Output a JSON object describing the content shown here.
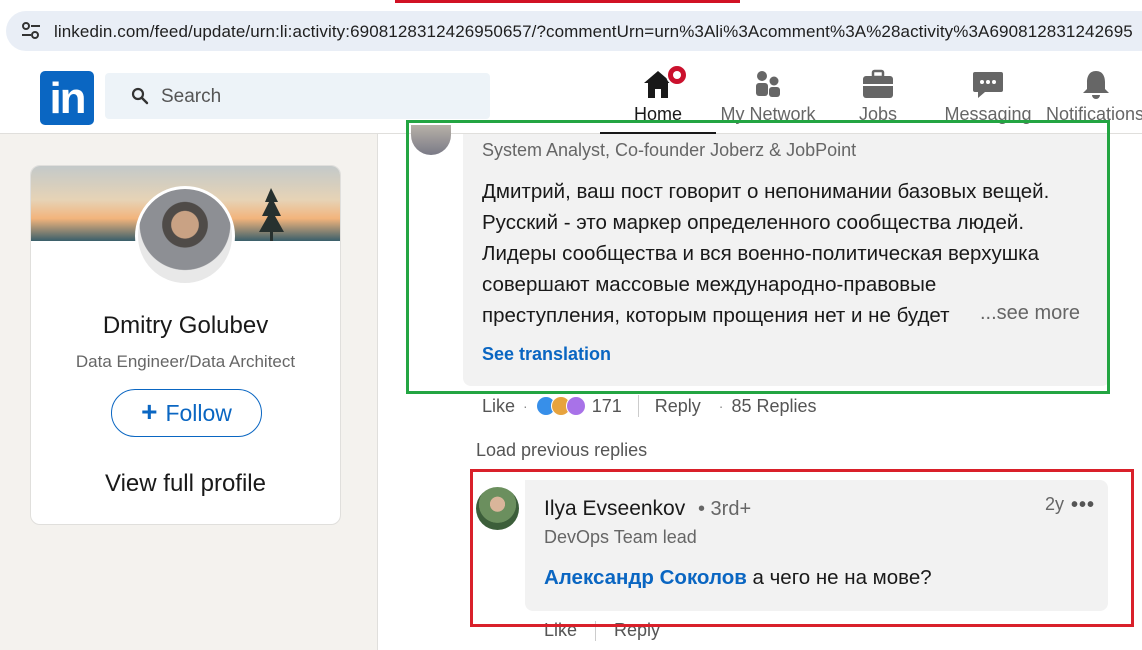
{
  "browser": {
    "url": "linkedin.com/feed/update/urn:li:activity:6908128312426950657/?commentUrn=urn%3Ali%3Acomment%3A%28activity%3A690812831242695"
  },
  "nav": {
    "logo": "in",
    "search_placeholder": "Search",
    "items": [
      {
        "label": "Home",
        "icon": "home-icon"
      },
      {
        "label": "My Network",
        "icon": "network-icon"
      },
      {
        "label": "Jobs",
        "icon": "jobs-icon"
      },
      {
        "label": "Messaging",
        "icon": "messaging-icon"
      },
      {
        "label": "Notifications",
        "icon": "notifications-icon"
      }
    ]
  },
  "profile_card": {
    "name": "Dmitry Golubev",
    "title": "Data Engineer/Data Architect",
    "follow_label": "Follow",
    "follow_plus": "+",
    "view_profile": "View full profile"
  },
  "comment1": {
    "subtitle": "System Analyst, Co-founder Joberz & JobPoint",
    "lines": [
      "Дмитрий, ваш пост говорит о непонимании базовых вещей.",
      "Русский - это маркер определенного сообщества людей.",
      "Лидеры сообщества и вся военно-политическая верхушка",
      "совершают массовые международно-правовые",
      "преступления, которым прощения нет и не будет"
    ],
    "see_more": "...see more",
    "see_translation": "See translation",
    "like": "Like",
    "dot": "·",
    "reactions_count": "171",
    "reply": "Reply",
    "replies": "85 Replies"
  },
  "load_previous": "Load previous replies",
  "comment2": {
    "author": "Ilya Evseenkov",
    "degree": "• 3rd+",
    "time": "2y",
    "more": "•••",
    "subtitle": "DevOps Team lead",
    "mention": "Александр Соколов",
    "text": " а чего не на мове?",
    "like": "Like",
    "reply": "Reply"
  },
  "colors": {
    "linkedin_blue": "#0a66c2",
    "highlight_green": "#23a542",
    "highlight_red": "#d9202a",
    "notification_red": "#cb112d"
  }
}
